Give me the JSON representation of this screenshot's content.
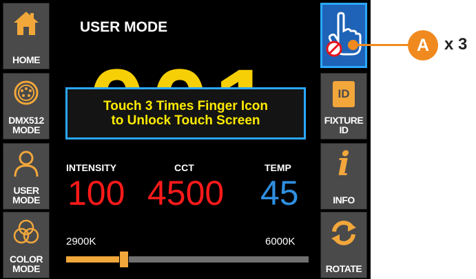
{
  "screen_title": "USER MODE",
  "user_number": "001",
  "lock_notice": {
    "line1": "Touch 3 Times Finger Icon",
    "line2": "to Unlock Touch Screen"
  },
  "left_menu": [
    {
      "label": "HOME",
      "icon": "home-icon"
    },
    {
      "label": "DMX512\nMODE",
      "icon": "dmx-connector-icon"
    },
    {
      "label": "USER\nMODE",
      "icon": "user-icon"
    },
    {
      "label": "COLOR\nMODE",
      "icon": "color-circles-icon"
    }
  ],
  "right_menu": [
    {
      "label": "",
      "icon": "finger-lock-icon",
      "state": "active"
    },
    {
      "label": "FIXTURE\nID",
      "icon": "id-icon",
      "badge": "ID"
    },
    {
      "label": "INFO",
      "icon": "info-icon",
      "glyph": "i"
    },
    {
      "label": "ROTATE",
      "icon": "rotate-icon"
    }
  ],
  "params": {
    "intensity_label": "INTENSITY",
    "intensity_value": "100",
    "cct_label": "CCT",
    "cct_value": "4500",
    "temp_label": "TEMP",
    "temp_value": "45"
  },
  "slider": {
    "min_label": "2900K",
    "max_label": "6000K",
    "position_fraction": 0.24
  },
  "callout": {
    "letter": "A",
    "text": "x 3"
  },
  "colors": {
    "accent_blue": "#2aa8ff",
    "value_red": "#ff1a1a",
    "temp_blue": "#2f8fe0",
    "callout_orange": "#f08a1e",
    "big_number_yellow": "#f6cf07"
  }
}
